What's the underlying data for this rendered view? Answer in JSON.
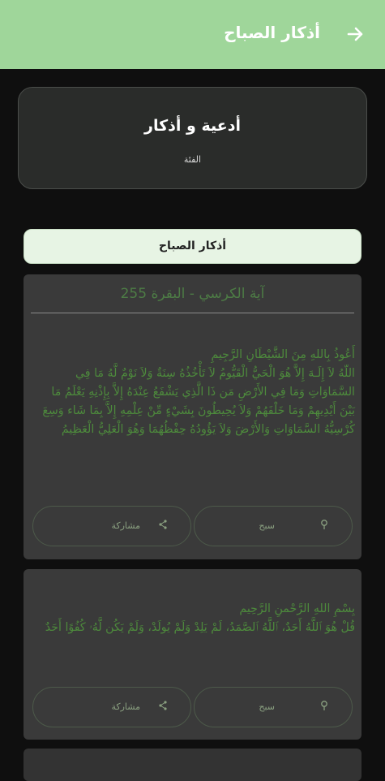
{
  "header": {
    "title": "أذكار الصباح",
    "background": "#9fd69a"
  },
  "category": {
    "title": "أدعية و أذكار",
    "subtitle": "الفئة"
  },
  "section": {
    "label": "أذكار الصباح"
  },
  "cards": [
    {
      "title": "آية الكرسي - البقرة 255",
      "text": "أَعُوذُ بِاللهِ مِنَ الشَّيْطَانِ الرَّجِيمِ\nاللّهُ لاَ إِلَـهَ إِلاَّ هُوَ الْحَيُّ الْقَيُّومُ لاَ تَأْخُذُهُ سِنَةٌ وَلاَ نَوْمٌ لَّهُ مَا فِي السَّمَاوَاتِ وَمَا فِي الأَرْضِ مَن ذَا الَّذِي يَشْفَعُ عِنْدَهُ إِلاَّ بِإِذْنِهِ يَعْلَمُ مَا بَيْنَ أَيْدِيهِمْ وَمَا خَلْفَهُمْ وَلاَ يُحِيطُونَ بِشَيْءٍ مِّنْ عِلْمِهِ إِلاَّ بِمَا شَاء وَسِعَ كُرْسِيُّهُ السَّمَاوَاتِ وَالأَرْضَ وَلاَ يَؤُودُهُ حِفْظُهُمَا وَهُوَ الْعَلِيُّ الْعَظِيمُ",
      "count_label": "سبح",
      "share_label": "مشاركة"
    },
    {
      "title": "",
      "text": "بِسْمِ اللهِ الرَّحْمنِ الرَّحِيم\nقُلْ هُوَ ٱللَّهُ أَحَدٌ، ٱللَّهُ ٱلصَّمَدُ، لَمْ يَلِدْ وَلَمْ يُولَدْ، وَلَمْ يَكُن لَّهُۥ كُفُوًا أَحَدٌ",
      "count_label": "سبح",
      "share_label": "مشاركة"
    }
  ],
  "icons": {
    "back": "arrow-right-icon",
    "count": "rosary-icon",
    "share": "share-icon"
  }
}
